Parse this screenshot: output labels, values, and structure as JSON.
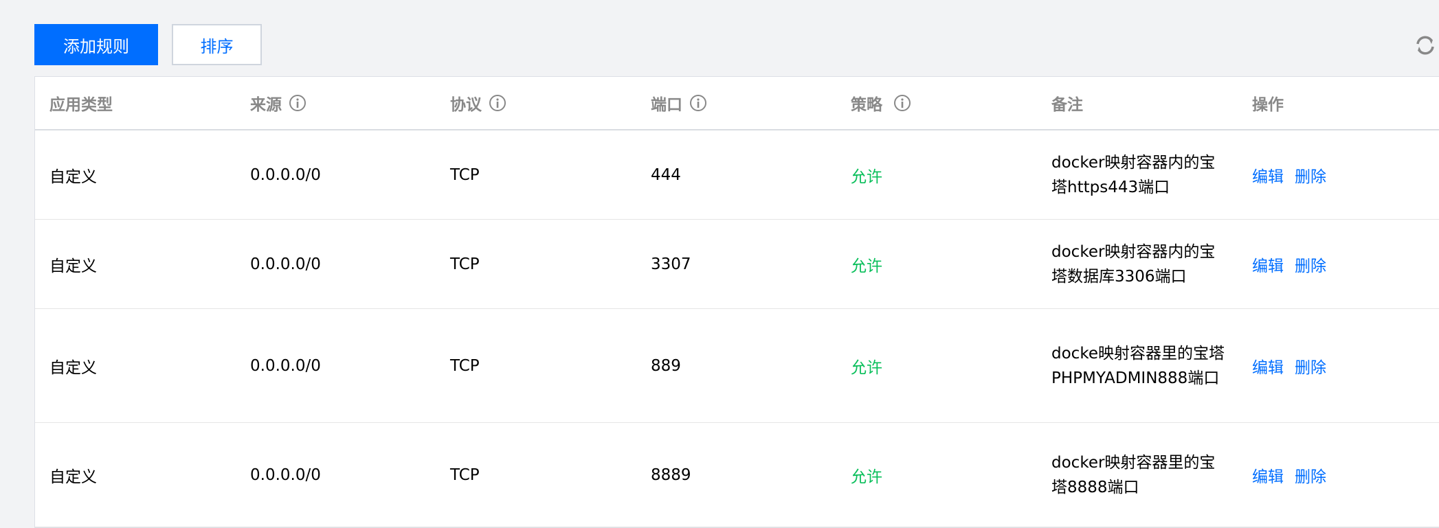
{
  "toolbar": {
    "add_rule": "添加规则",
    "sort": "排序"
  },
  "table": {
    "headers": {
      "app_type": "应用类型",
      "source": "来源",
      "protocol": "协议",
      "port": "端口",
      "policy": "策略",
      "remark": "备注",
      "actions": "操作"
    },
    "rows": [
      {
        "app_type": "自定义",
        "source": "0.0.0.0/0",
        "protocol": "TCP",
        "port": "444",
        "policy": "允许",
        "remark": "docker映射容器内的宝塔https443端口",
        "edit": "编辑",
        "delete": "删除"
      },
      {
        "app_type": "自定义",
        "source": "0.0.0.0/0",
        "protocol": "TCP",
        "port": "3307",
        "policy": "允许",
        "remark": "docker映射容器内的宝塔数据库3306端口",
        "edit": "编辑",
        "delete": "删除"
      },
      {
        "app_type": "自定义",
        "source": "0.0.0.0/0",
        "protocol": "TCP",
        "port": "889",
        "policy": "允许",
        "remark": "docke映射容器里的宝塔PHPMYADMIN888端口",
        "edit": "编辑",
        "delete": "删除"
      },
      {
        "app_type": "自定义",
        "source": "0.0.0.0/0",
        "protocol": "TCP",
        "port": "8889",
        "policy": "允许",
        "remark": "docker映射容器里的宝塔8888端口",
        "edit": "编辑",
        "delete": "删除"
      }
    ]
  },
  "icons": {
    "info": "info-circle-icon",
    "refresh": "refresh-icon"
  },
  "colors": {
    "primary": "#006eff",
    "allow": "#0abf5b",
    "header_text": "#888888",
    "background": "#f2f3f5"
  }
}
